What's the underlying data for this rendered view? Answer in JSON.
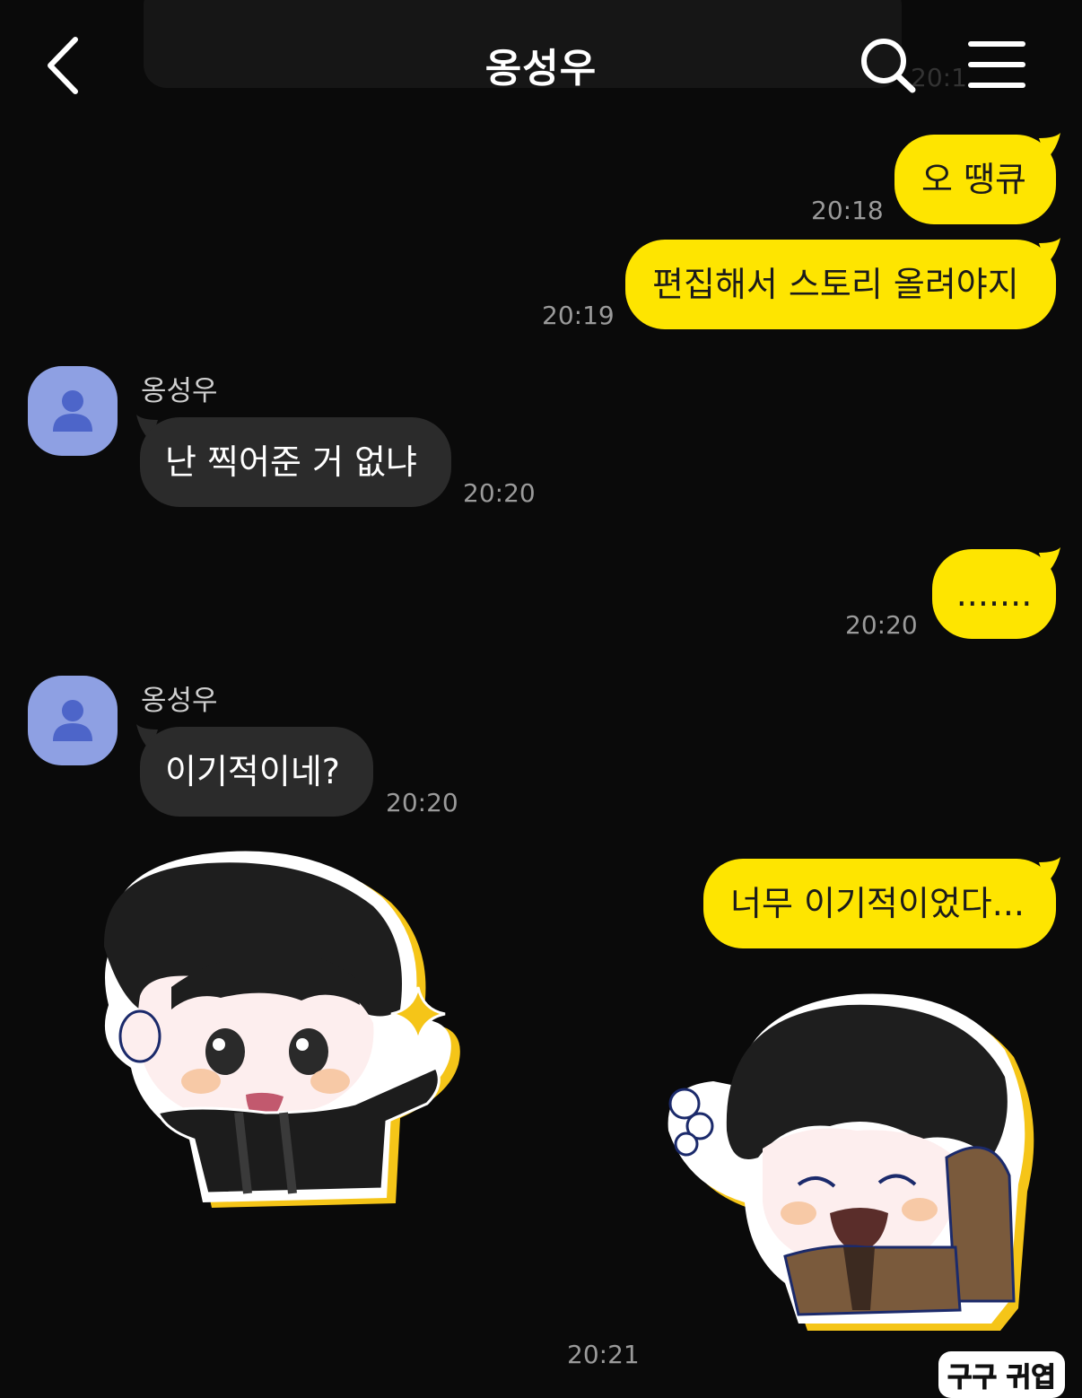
{
  "header": {
    "title": "옹성우",
    "back_icon": "chevron-left-icon",
    "search_icon": "search-icon",
    "menu_icon": "hamburger-menu-icon"
  },
  "previous_time": "20:1",
  "messages": [
    {
      "from": "me",
      "text": "오 땡큐",
      "time": "20:18"
    },
    {
      "from": "me",
      "text": "편집해서 스토리 올려야지",
      "time": "20:19"
    },
    {
      "from": "other",
      "sender": "옹성우",
      "text": "난 찍어준 거 없냐",
      "time": "20:20"
    },
    {
      "from": "me",
      "text": ".......",
      "time": "20:20"
    },
    {
      "from": "other",
      "sender": "옹성우",
      "text": "이기적이네?",
      "time": "20:20"
    },
    {
      "from": "me",
      "text": "너무 이기적이었다...",
      "time": ""
    }
  ],
  "sticker_time": "20:21",
  "signature": "구구 귀엽",
  "colors": {
    "my_bubble": "#fee500",
    "their_bubble": "#2b2b2b",
    "avatar": "#8ea0e3",
    "background": "#0a0a0a"
  }
}
